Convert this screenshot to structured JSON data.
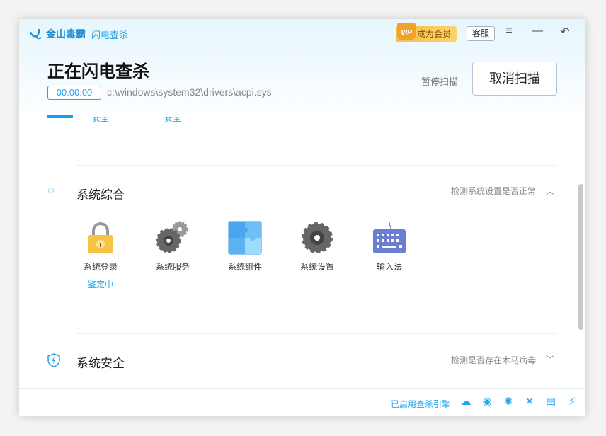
{
  "app": {
    "brand": "金山毒霸",
    "module": "闪电查杀"
  },
  "titlebar": {
    "vip_label": "成为会员",
    "vip_badge": "VIP",
    "service_label": "客服",
    "menu_icon": "≡",
    "min_icon": "—",
    "back_icon": "↶"
  },
  "scan": {
    "title": "正在闪电查杀",
    "elapsed": "00:00:00",
    "current_file": "c:\\windows\\system32\\drivers\\acpi.sys",
    "pause_label": "暂停扫描",
    "cancel_label": "取消扫描"
  },
  "tabs": [
    {
      "label": "安全"
    },
    {
      "label": "安全"
    }
  ],
  "sections": [
    {
      "title": "系统综合",
      "desc": "检测系统设置是否正常",
      "expanded": true,
      "items": [
        {
          "label": "系统登录",
          "status": "鉴定中"
        },
        {
          "label": "系统服务",
          "status": "`"
        },
        {
          "label": "系统组件",
          "status": ""
        },
        {
          "label": "系统设置",
          "status": ""
        },
        {
          "label": "输入法",
          "status": ""
        }
      ]
    },
    {
      "title": "系统安全",
      "desc": "检测是否存在木马病毒",
      "expanded": false
    }
  ],
  "footer": {
    "engine_label": "已启用查杀引擎"
  },
  "colors": {
    "accent": "#22a4ef",
    "vip": "#f7c04a"
  }
}
